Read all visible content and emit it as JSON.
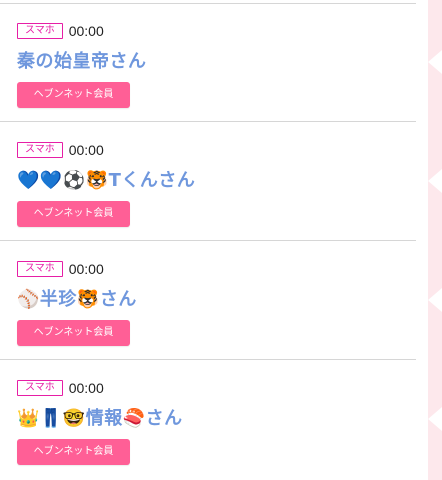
{
  "entries": [
    {
      "device": "スマホ",
      "time": "00:00",
      "name": "秦の始皇帝さん",
      "badge": "ヘブンネット会員"
    },
    {
      "device": "スマホ",
      "time": "00:00",
      "name": "💙💙⚽🐯Tくんさん",
      "badge": "ヘブンネット会員"
    },
    {
      "device": "スマホ",
      "time": "00:00",
      "name": "⚾半珍🐯さん",
      "badge": "ヘブンネット会員"
    },
    {
      "device": "スマホ",
      "time": "00:00",
      "name": "👑👖🤓情報🍣さん",
      "badge": "ヘブンネット会員"
    }
  ],
  "colors": {
    "device_tag": "#e61ea6",
    "name": "#6f97dd",
    "badge_bg": "#ff5f96",
    "side_strip": "#fde8ec"
  }
}
